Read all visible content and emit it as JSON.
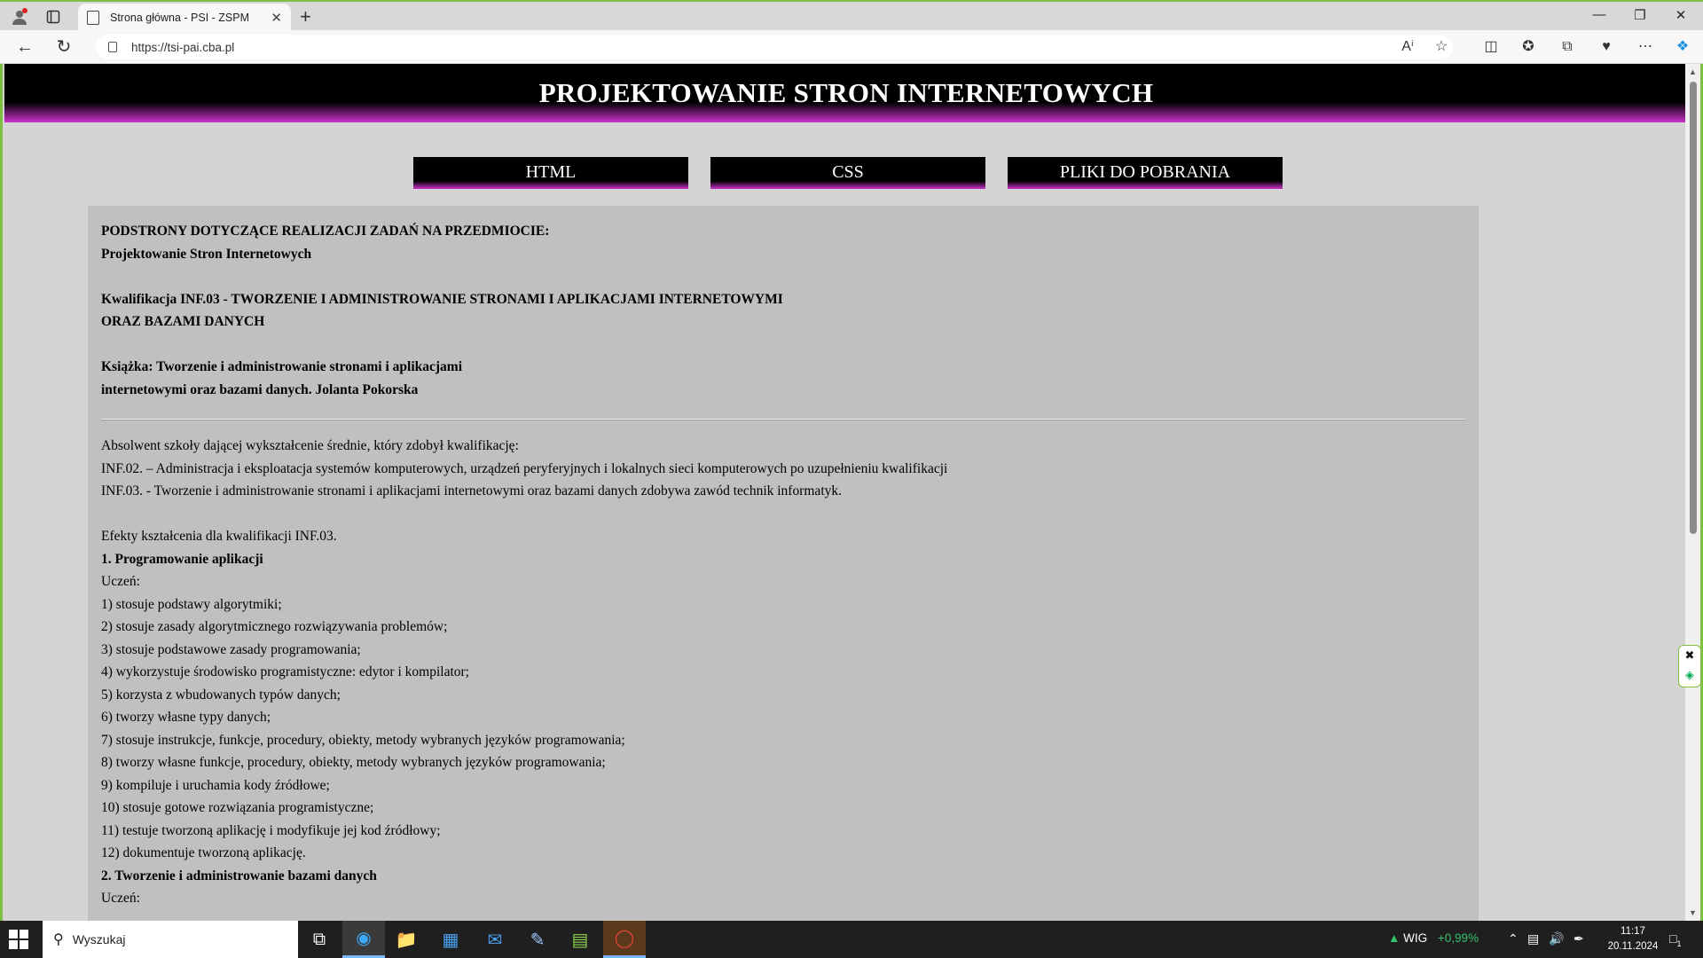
{
  "browser": {
    "tab_title": "Strona główna - PSI - ZSPM",
    "url": "https://tsi-pai.cba.pl",
    "new_tab_glyph": "+",
    "close_tab_glyph": "✕"
  },
  "site": {
    "title": "PROJEKTOWANIE STRON INTERNETOWYCH",
    "nav": [
      "HTML",
      "CSS",
      "PLIKI DO POBRANIA"
    ]
  },
  "content": {
    "intro": [
      "PODSTRONY DOTYCZĄCE REALIZACJI ZADAŃ NA PRZEDMIOCIE:",
      "Projektowanie Stron Internetowych"
    ],
    "qualification": [
      "Kwalifikacja INF.03 - TWORZENIE I ADMINISTROWANIE STRONAMI I APLIKACJAMI INTERNETOWYMI",
      "ORAZ BAZAMI DANYCH"
    ],
    "book": [
      "Książka: Tworzenie i administrowanie stronami i aplikacjami",
      "internetowymi oraz bazami danych. Jolanta Pokorska"
    ],
    "graduate": [
      "Absolwent szkoły dającej wykształcenie średnie, który zdobył kwalifikację:",
      "INF.02. – Administracja i eksploatacja systemów komputerowych, urządzeń peryferyjnych i lokalnych sieci komputerowych po uzupełnieniu kwalifikacji",
      "INF.03. - Tworzenie i administrowanie stronami i aplikacjami internetowymi oraz bazami danych zdobywa zawód technik informatyk."
    ],
    "effects_heading": "Efekty kształcenia dla kwalifikacji INF.03.",
    "section1_title": "1. Programowanie aplikacji",
    "student_label": "Uczeń:",
    "section1_items": [
      "1) stosuje podstawy algorytmiki;",
      "2) stosuje zasady algorytmicznego rozwiązywania problemów;",
      "3) stosuje podstawowe zasady programowania;",
      "4) wykorzystuje środowisko programistyczne: edytor i kompilator;",
      "5) korzysta z wbudowanych typów danych;",
      "6) tworzy własne typy danych;",
      "7) stosuje instrukcje, funkcje, procedury, obiekty, metody wybranych języków programowania;",
      "8) tworzy własne funkcje, procedury, obiekty, metody wybranych języków programowania;",
      "9) kompiluje i uruchamia kody źródłowe;",
      "10) stosuje gotowe rozwiązania programistyczne;",
      "11) testuje tworzoną aplikację i modyfikuje jej kod źródłowy;",
      "12) dokumentuje tworzoną aplikację."
    ],
    "section2_title": "2. Tworzenie i administrowanie bazami danych",
    "section2_student_label": "Uczeń:"
  },
  "taskbar": {
    "search_placeholder": "Wyszukaj",
    "stock_name": "WIG",
    "stock_change": "+0,99%",
    "time": "11:17",
    "date": "20.11.2024",
    "notification_count": "1"
  },
  "colors": {
    "header_gradient_end": "#cc33cc",
    "content_bg": "#c0c0c0",
    "page_bg": "#d4d4d4",
    "stock_up": "#36c26a"
  }
}
